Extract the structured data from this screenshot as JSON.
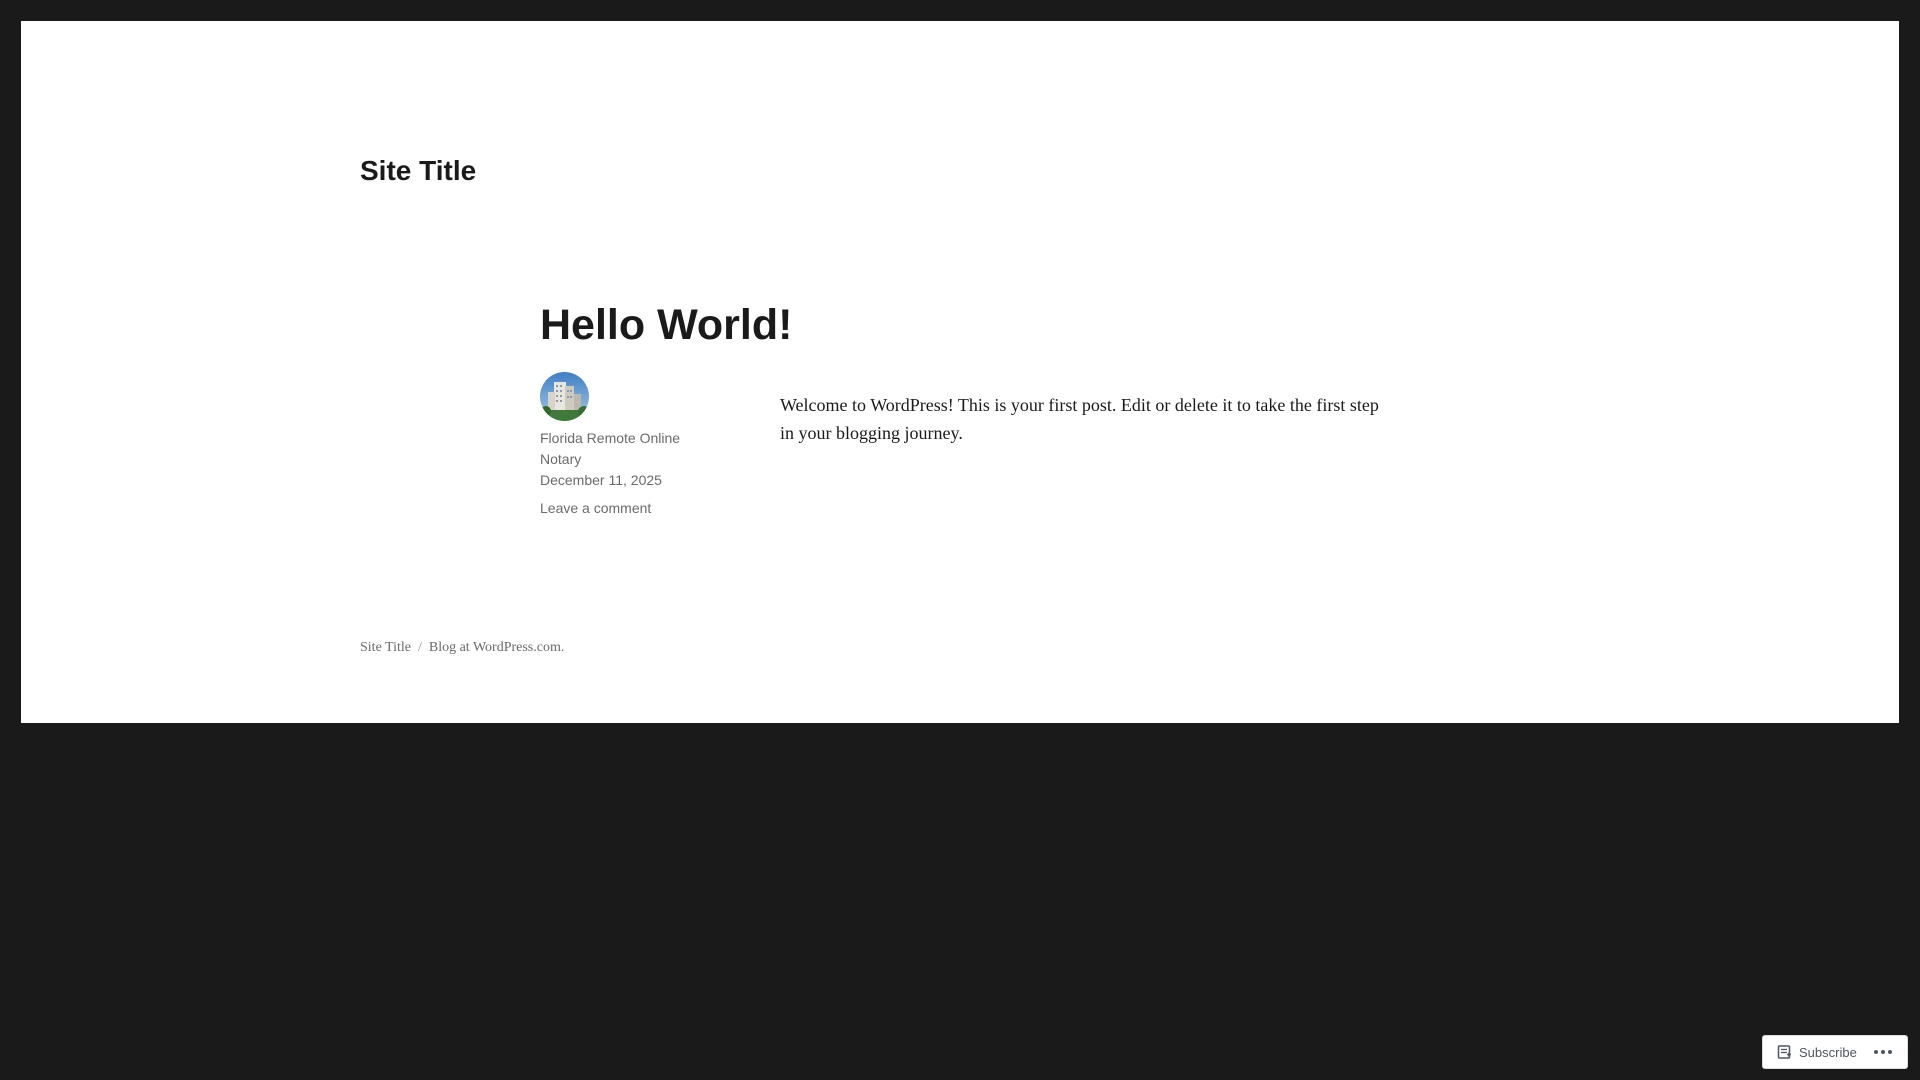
{
  "header": {
    "site_title": "Site Title"
  },
  "post": {
    "title": "Hello World!",
    "author": "Florida Remote Online Notary",
    "date": "December 11, 2025",
    "comment_link": "Leave a comment",
    "content": "Welcome to WordPress! This is your first post. Edit or delete it to take the first step in your blogging journey.",
    "avatar_icon": "building-photo-avatar"
  },
  "footer": {
    "site_title": "Site Title",
    "separator": "/",
    "credit": "Blog at WordPress.com."
  },
  "actionbar": {
    "subscribe_label": "Subscribe",
    "subscribe_icon": "reader-icon",
    "more_icon": "ellipsis-icon"
  },
  "colors": {
    "frame_background": "#1a1a1a",
    "page_background": "#ffffff",
    "text": "#1a1a1a",
    "meta_text": "#6b6b6b"
  }
}
